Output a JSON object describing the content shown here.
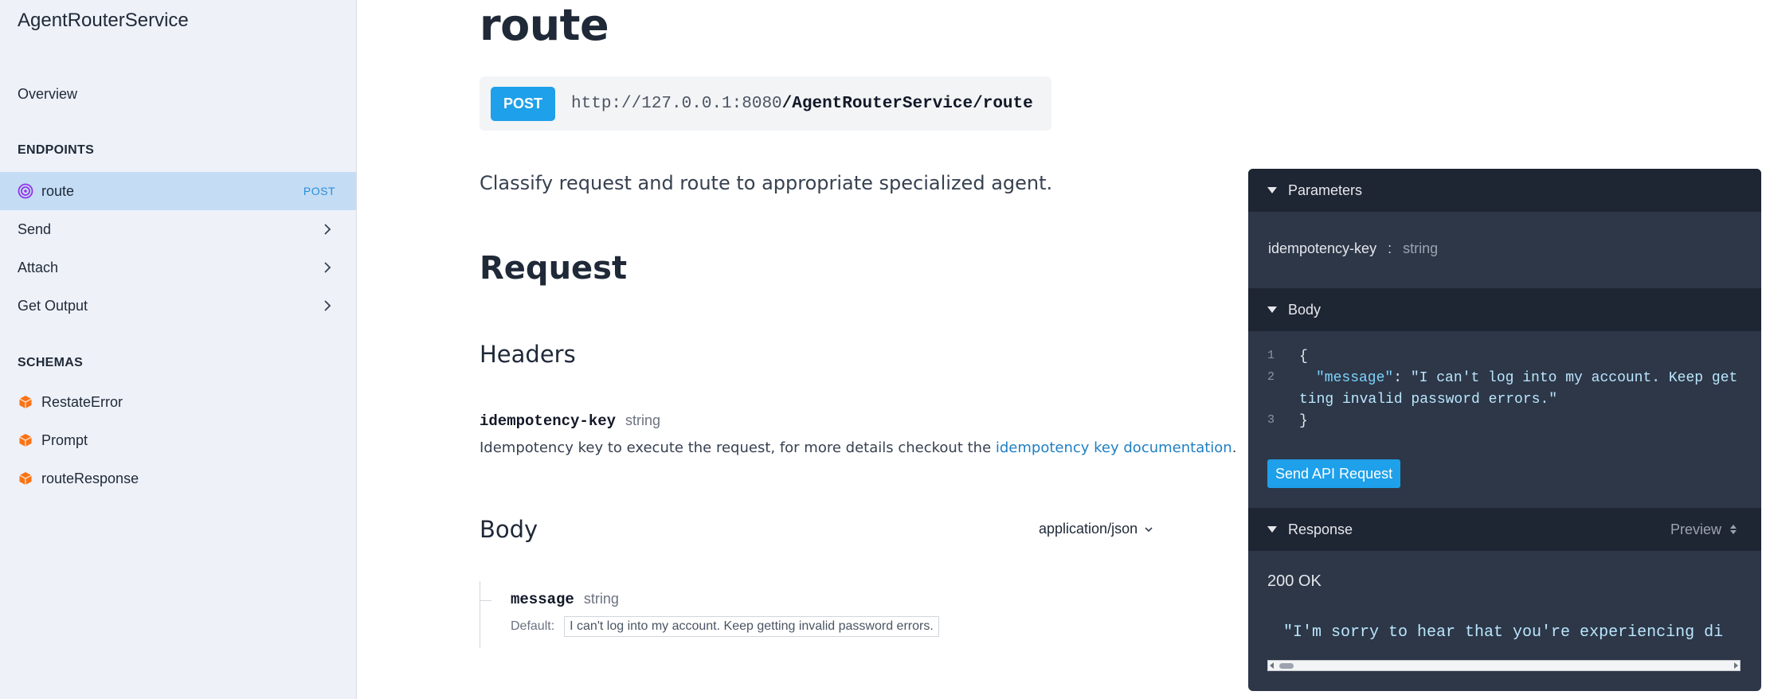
{
  "sidebar": {
    "brand": "AgentRouterService",
    "overview": "Overview",
    "endpoints_heading": "ENDPOINTS",
    "endpoints": [
      {
        "label": "route",
        "method": "POST",
        "icon": "target-icon",
        "active": true
      },
      {
        "label": "Send",
        "icon": "chevron-right-icon"
      },
      {
        "label": "Attach",
        "icon": "chevron-right-icon"
      },
      {
        "label": "Get Output",
        "icon": "chevron-right-icon"
      }
    ],
    "schemas_heading": "SCHEMAS",
    "schemas": [
      {
        "label": "RestateError",
        "icon": "cube-icon"
      },
      {
        "label": "Prompt",
        "icon": "cube-icon"
      },
      {
        "label": "routeResponse",
        "icon": "cube-icon"
      }
    ]
  },
  "main": {
    "title": "route",
    "method": "POST",
    "url_host": "http://127.0.0.1:8080",
    "url_path": "/AgentRouterService/route",
    "description": "Classify request and route to appropriate specialized agent.",
    "request_heading": "Request",
    "headers_heading": "Headers",
    "header_param": {
      "name": "idempotency-key",
      "type": "string",
      "desc_prefix": "Idempotency key to execute the request, for more details checkout the ",
      "link_text": "idempotency key documentation",
      "desc_suffix": "."
    },
    "body_heading": "Body",
    "content_type": "application/json",
    "body_field": {
      "name": "message",
      "type": "string",
      "default_label": "Default:",
      "default_value": "I can't log into my account. Keep getting invalid password errors."
    }
  },
  "panel": {
    "parameters_label": "Parameters",
    "param_name": "idempotency-key",
    "param_sep": ":",
    "param_type": "string",
    "body_label": "Body",
    "code_lines": {
      "n1": "1",
      "n2": "2",
      "n3": "3",
      "open": "{",
      "key": "\"message\"",
      "colon": ": ",
      "value_part1": "\"I can't log into my account. Keep get",
      "value_part2": "ting invalid password errors.\"",
      "close": "}"
    },
    "send_button": "Send API Request",
    "response_label": "Response",
    "preview_label": "Preview",
    "status": "200 OK",
    "response_text": "\"I'm sorry to hear that you're experiencing di"
  },
  "colors": {
    "accent": "#1ea0ea",
    "active_item_bg": "#c4dcf4",
    "sidebar_bg": "#eef1f8",
    "panel_bg": "#2d3748",
    "panel_header_bg": "#1e2533",
    "target_icon": "#9333ea",
    "cube_icon": "#f97316"
  }
}
